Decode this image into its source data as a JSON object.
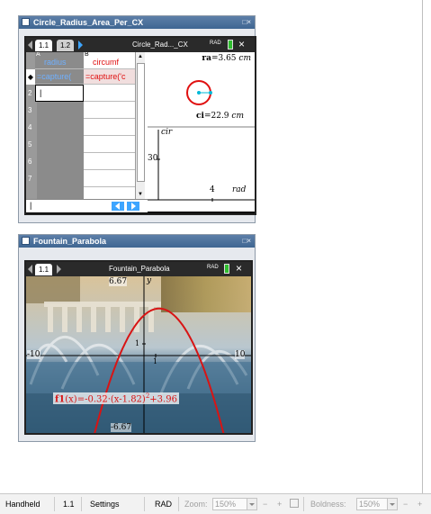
{
  "panel1": {
    "title": "Circle_Radius_Area_Per_CX",
    "controls": "□×",
    "tab1": "1.1",
    "tab2": "1.2",
    "doc_name": "Circle_Rad..._CX",
    "angle_mode": "RAD",
    "spreadsheet": {
      "colA_letter": "A",
      "colA_name": "radius",
      "colB_letter": "B",
      "colB_name": "circumf",
      "formula_A": "=capture(",
      "formula_B": "=capture('c",
      "row_labels": [
        "2",
        "3",
        "4",
        "5",
        "6",
        "7"
      ],
      "formula_row_marker": "◆"
    },
    "geometry": {
      "ra_label": "ra",
      "ra_value": "=3.65",
      "ra_unit": "cm",
      "ci_label": "ci",
      "ci_value": "=22.9",
      "ci_unit": "cm"
    },
    "graph": {
      "y_axis_label": "cir",
      "x_axis_label": "rad",
      "y_tick": "30",
      "x_tick": "4"
    }
  },
  "panel2": {
    "title": "Fountain_Parabola",
    "controls": "□×",
    "tab1": "1.1",
    "doc_name": "Fountain_Parabola",
    "angle_mode": "RAD",
    "graph": {
      "y_axis_label": "y",
      "y_max_label": "6.67",
      "y_min_label": "-6.67",
      "x_min_label": "-10",
      "x_max_label": "10",
      "x_tick_1": "1",
      "y_tick_1": "1",
      "function_name": "f1",
      "function_expr": "(x)=-0.32·(x-1.82)",
      "function_exp": "2",
      "function_tail": "+3.96"
    }
  },
  "statusbar": {
    "handheld": "Handheld",
    "page": "1.1",
    "settings": "Settings",
    "rad": "RAD",
    "zoom_label": "Zoom:",
    "zoom_value": "150%",
    "zoom_minus": "−",
    "zoom_plus": "+",
    "boldness_label": "Boldness:",
    "boldness_value": "150%",
    "boldness_minus": "−",
    "boldness_plus": "+"
  },
  "colors": {
    "title_bar": "#4a70a0",
    "accent_red": "#e01010",
    "accent_blue": "#3da5ff",
    "cyan_point": "#00b8d8",
    "battery_green": "#2fbe2f"
  }
}
